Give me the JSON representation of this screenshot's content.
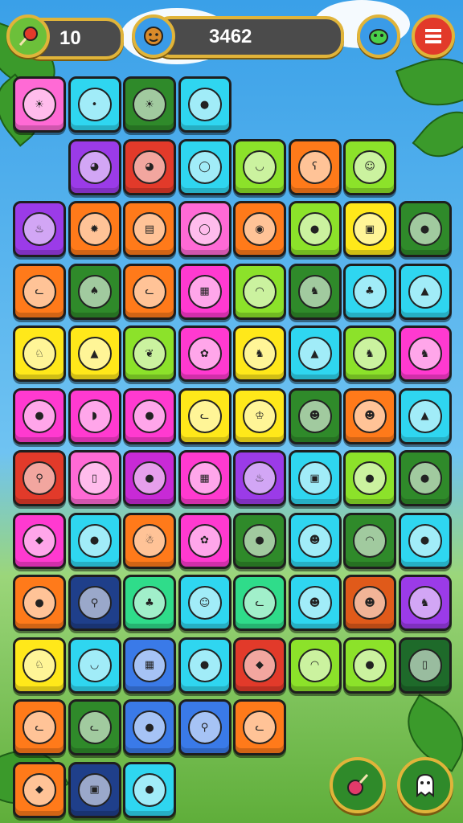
{
  "hud": {
    "moves_value": "10",
    "score_value": "3462",
    "moves_icon": "lollipop-icon",
    "avatar_icon": "monkey-avatar-icon",
    "friend_icon": "green-creature-icon",
    "menu_icon": "menu-icon"
  },
  "tile_colors": [
    "#ff6ad5",
    "#ff7a1a",
    "#2fd6f0",
    "#9b3be8",
    "#e23a2a",
    "#8ce22a",
    "#ffe81a",
    "#2f8a2a",
    "#ff3ad0",
    "#1f3f8a",
    "#2fdc8a",
    "#3a7ae8",
    "#c82ad6",
    "#e05a1a",
    "#1e6a2a"
  ],
  "tiles": [
    {
      "c": 0,
      "r": 0,
      "color": 0,
      "icon": "sun-icon",
      "glyph": "☀"
    },
    {
      "c": 1,
      "r": 0,
      "color": 2,
      "icon": "robot-ball-icon",
      "glyph": "•"
    },
    {
      "c": 2,
      "r": 0,
      "color": 7,
      "icon": "sun-icon",
      "glyph": "☀"
    },
    {
      "c": 3,
      "r": 0,
      "color": 2,
      "icon": "orange-ball-icon",
      "glyph": "●"
    },
    {
      "c": 1,
      "r": 1,
      "color": 3,
      "icon": "alien-head-icon",
      "glyph": "◕"
    },
    {
      "c": 2,
      "r": 1,
      "color": 4,
      "icon": "alien-head-icon",
      "glyph": "◕"
    },
    {
      "c": 3,
      "r": 1,
      "color": 2,
      "icon": "balloon-icon",
      "glyph": "◯"
    },
    {
      "c": 4,
      "r": 1,
      "color": 5,
      "icon": "green-blob-icon",
      "glyph": "◡"
    },
    {
      "c": 5,
      "r": 1,
      "color": 1,
      "icon": "purple-bear-icon",
      "glyph": "ʕ"
    },
    {
      "c": 6,
      "r": 1,
      "color": 5,
      "icon": "smiley-icon",
      "glyph": "☺"
    },
    {
      "c": 0,
      "r": 2,
      "color": 3,
      "icon": "drumstick-icon",
      "glyph": "♨"
    },
    {
      "c": 1,
      "r": 2,
      "color": 1,
      "icon": "lion-icon",
      "glyph": "✹"
    },
    {
      "c": 2,
      "r": 2,
      "color": 1,
      "icon": "jar-icon",
      "glyph": "▤"
    },
    {
      "c": 3,
      "r": 2,
      "color": 0,
      "icon": "balloon-creature-icon",
      "glyph": "◯"
    },
    {
      "c": 4,
      "r": 2,
      "color": 1,
      "icon": "monkey-face-icon",
      "glyph": "◉"
    },
    {
      "c": 5,
      "r": 2,
      "color": 5,
      "icon": "plum-icon",
      "glyph": "●"
    },
    {
      "c": 6,
      "r": 2,
      "color": 6,
      "icon": "treasure-box-icon",
      "glyph": "▣"
    },
    {
      "c": 7,
      "r": 2,
      "color": 7,
      "icon": "lemon-pop-icon",
      "glyph": "●"
    },
    {
      "c": 0,
      "r": 3,
      "color": 1,
      "icon": "cat-head-icon",
      "glyph": "ᓚ"
    },
    {
      "c": 1,
      "r": 3,
      "color": 7,
      "icon": "pepper-icon",
      "glyph": "♠"
    },
    {
      "c": 2,
      "r": 3,
      "color": 1,
      "icon": "purple-cat-icon",
      "glyph": "ᓚ"
    },
    {
      "c": 3,
      "r": 3,
      "color": 8,
      "icon": "gift-box-icon",
      "glyph": "▦"
    },
    {
      "c": 4,
      "r": 3,
      "color": 5,
      "icon": "ghost-icon",
      "glyph": "◠"
    },
    {
      "c": 5,
      "r": 3,
      "color": 7,
      "icon": "dog-icon",
      "glyph": "♞"
    },
    {
      "c": 6,
      "r": 3,
      "color": 2,
      "icon": "octopus-icon",
      "glyph": "♣"
    },
    {
      "c": 7,
      "r": 3,
      "color": 2,
      "icon": "hooded-gnome-icon",
      "glyph": "▲"
    },
    {
      "c": 0,
      "r": 4,
      "color": 6,
      "icon": "dino-icon",
      "glyph": "♘"
    },
    {
      "c": 1,
      "r": 4,
      "color": 6,
      "icon": "cone-icon",
      "glyph": "▲"
    },
    {
      "c": 2,
      "r": 4,
      "color": 5,
      "icon": "green-leaf-icon",
      "glyph": "❦"
    },
    {
      "c": 3,
      "r": 4,
      "color": 8,
      "icon": "chicken-icon",
      "glyph": "✿"
    },
    {
      "c": 4,
      "r": 4,
      "color": 6,
      "icon": "brown-dog-icon",
      "glyph": "♞"
    },
    {
      "c": 5,
      "r": 4,
      "color": 2,
      "icon": "hooded-gnome-icon",
      "glyph": "▲"
    },
    {
      "c": 6,
      "r": 4,
      "color": 5,
      "icon": "brown-dog-icon",
      "glyph": "♞"
    },
    {
      "c": 7,
      "r": 4,
      "color": 8,
      "icon": "pink-dog-icon",
      "glyph": "♞"
    },
    {
      "c": 0,
      "r": 5,
      "color": 8,
      "icon": "pear-icon",
      "glyph": "●"
    },
    {
      "c": 1,
      "r": 5,
      "color": 8,
      "icon": "whale-icon",
      "glyph": "◗"
    },
    {
      "c": 2,
      "r": 5,
      "color": 8,
      "icon": "grape-icon",
      "glyph": "●"
    },
    {
      "c": 3,
      "r": 5,
      "color": 6,
      "icon": "orange-cat-icon",
      "glyph": "ᓚ"
    },
    {
      "c": 4,
      "r": 5,
      "color": 6,
      "icon": "rooster-icon",
      "glyph": "♔"
    },
    {
      "c": 5,
      "r": 5,
      "color": 7,
      "icon": "blue-gnome-icon",
      "glyph": "☻"
    },
    {
      "c": 6,
      "r": 5,
      "color": 1,
      "icon": "red-cap-kid-icon",
      "glyph": "☻"
    },
    {
      "c": 7,
      "r": 5,
      "color": 2,
      "icon": "cone-icon",
      "glyph": "▲"
    },
    {
      "c": 0,
      "r": 6,
      "color": 4,
      "icon": "bone-icon",
      "glyph": "⚲"
    },
    {
      "c": 1,
      "r": 6,
      "color": 0,
      "icon": "mug-icon",
      "glyph": "▯"
    },
    {
      "c": 2,
      "r": 6,
      "color": 12,
      "icon": "candy-apple-icon",
      "glyph": "●"
    },
    {
      "c": 3,
      "r": 6,
      "color": 8,
      "icon": "gift-box-icon",
      "glyph": "▦"
    },
    {
      "c": 4,
      "r": 6,
      "color": 3,
      "icon": "drumstick-icon",
      "glyph": "♨"
    },
    {
      "c": 5,
      "r": 6,
      "color": 2,
      "icon": "robot-face-icon",
      "glyph": "▣"
    },
    {
      "c": 6,
      "r": 6,
      "color": 5,
      "icon": "candy-pop-icon",
      "glyph": "●"
    },
    {
      "c": 7,
      "r": 6,
      "color": 7,
      "icon": "melon-icon",
      "glyph": "●"
    },
    {
      "c": 0,
      "r": 7,
      "color": 8,
      "icon": "shield-gem-icon",
      "glyph": "◆"
    },
    {
      "c": 1,
      "r": 7,
      "color": 2,
      "icon": "cherry-pop-icon",
      "glyph": "●"
    },
    {
      "c": 2,
      "r": 7,
      "color": 1,
      "icon": "snowman-icon",
      "glyph": "☃"
    },
    {
      "c": 3,
      "r": 7,
      "color": 8,
      "icon": "star-chick-icon",
      "glyph": "✿"
    },
    {
      "c": 4,
      "r": 7,
      "color": 7,
      "icon": "cookie-icon",
      "glyph": "●"
    },
    {
      "c": 5,
      "r": 7,
      "color": 2,
      "icon": "blonde-kid-icon",
      "glyph": "☻"
    },
    {
      "c": 6,
      "r": 7,
      "color": 7,
      "icon": "green-ghost-icon",
      "glyph": "◠"
    },
    {
      "c": 7,
      "r": 7,
      "color": 2,
      "icon": "cherry-pop-icon",
      "glyph": "●"
    },
    {
      "c": 0,
      "r": 8,
      "color": 1,
      "icon": "hedgehog-icon",
      "glyph": "●"
    },
    {
      "c": 1,
      "r": 8,
      "color": 9,
      "icon": "spoon-icon",
      "glyph": "⚲"
    },
    {
      "c": 2,
      "r": 8,
      "color": 10,
      "icon": "tree-stump-icon",
      "glyph": "♣"
    },
    {
      "c": 3,
      "r": 8,
      "color": 2,
      "icon": "monkey-smile-icon",
      "glyph": "☺"
    },
    {
      "c": 4,
      "r": 8,
      "color": 10,
      "icon": "grey-cat-icon",
      "glyph": "ᓚ"
    },
    {
      "c": 5,
      "r": 8,
      "color": 2,
      "icon": "brown-gnome-icon",
      "glyph": "☻"
    },
    {
      "c": 6,
      "r": 8,
      "color": 13,
      "icon": "girl-face-icon",
      "glyph": "☻"
    },
    {
      "c": 7,
      "r": 8,
      "color": 3,
      "icon": "orange-dog-icon",
      "glyph": "♞"
    },
    {
      "c": 0,
      "r": 9,
      "color": 6,
      "icon": "dino-icon",
      "glyph": "♘"
    },
    {
      "c": 1,
      "r": 9,
      "color": 2,
      "icon": "green-blob-icon",
      "glyph": "◡"
    },
    {
      "c": 2,
      "r": 9,
      "color": 11,
      "icon": "crate-icon",
      "glyph": "▦"
    },
    {
      "c": 3,
      "r": 9,
      "color": 2,
      "icon": "chick-icon",
      "glyph": "●"
    },
    {
      "c": 4,
      "r": 9,
      "color": 4,
      "icon": "dragon-fruit-icon",
      "glyph": "◆"
    },
    {
      "c": 5,
      "r": 9,
      "color": 5,
      "icon": "green-ghost-icon",
      "glyph": "◠"
    },
    {
      "c": 6,
      "r": 9,
      "color": 5,
      "icon": "candy-pop-icon",
      "glyph": "●"
    },
    {
      "c": 7,
      "r": 9,
      "color": 14,
      "icon": "mug-icon",
      "glyph": "▯"
    },
    {
      "c": 0,
      "r": 10,
      "color": 1,
      "icon": "purple-cat-icon",
      "glyph": "ᓚ"
    },
    {
      "c": 1,
      "r": 10,
      "color": 7,
      "icon": "cat-head-icon",
      "glyph": "ᓚ"
    },
    {
      "c": 2,
      "r": 10,
      "color": 11,
      "icon": "acorn-icon",
      "glyph": "●"
    },
    {
      "c": 3,
      "r": 10,
      "color": 11,
      "icon": "bone-icon",
      "glyph": "⚲"
    },
    {
      "c": 4,
      "r": 10,
      "color": 1,
      "icon": "white-cat-icon",
      "glyph": "ᓚ"
    },
    {
      "c": 0,
      "r": 11,
      "color": 1,
      "icon": "fish-icon",
      "glyph": "◆"
    },
    {
      "c": 1,
      "r": 11,
      "color": 9,
      "icon": "picture-frame-icon",
      "glyph": "▣"
    },
    {
      "c": 2,
      "r": 11,
      "color": 2,
      "icon": "melon-icon",
      "glyph": "●"
    }
  ],
  "buttons": {
    "booster_icon": "lollipop-booster-icon",
    "ghost_icon": "ghost-booster-icon"
  }
}
